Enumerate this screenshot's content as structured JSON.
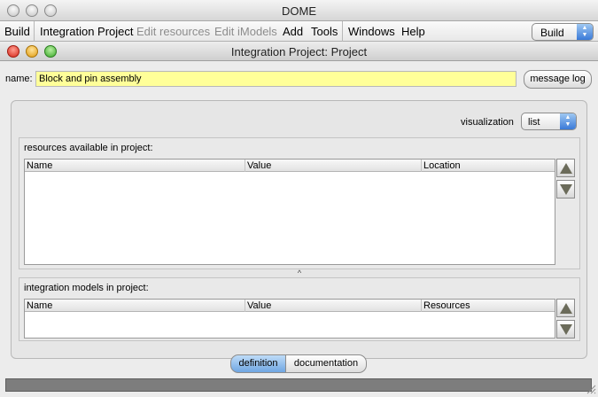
{
  "app": {
    "title": "DOME"
  },
  "menubar": {
    "items": [
      {
        "label": "Build"
      },
      {
        "label": "Integration Project"
      },
      {
        "label": "Edit resources"
      },
      {
        "label": "Edit iModels"
      },
      {
        "label": "Add"
      },
      {
        "label": "Tools"
      },
      {
        "label": "Windows"
      },
      {
        "label": "Help"
      }
    ],
    "mode_select": "Build"
  },
  "window": {
    "title": "Integration Project: Project"
  },
  "name_row": {
    "label": "name:",
    "value": "Block and pin assembly",
    "message_log_label": "message log"
  },
  "visualization": {
    "label": "visualization",
    "value": "list"
  },
  "resources": {
    "title": "resources available in project:",
    "columns": [
      "Name",
      "Value",
      "Location"
    ],
    "rows": []
  },
  "models": {
    "title": "integration models in project:",
    "columns": [
      "Name",
      "Value",
      "Resources"
    ],
    "rows": []
  },
  "tabs": [
    {
      "label": "definition",
      "selected": true
    },
    {
      "label": "documentation",
      "selected": false
    }
  ],
  "colors": {
    "name_field_bg": "#ffff99",
    "selected_tab": "#6fa6e2",
    "status_bar": "#7d7d7d"
  }
}
